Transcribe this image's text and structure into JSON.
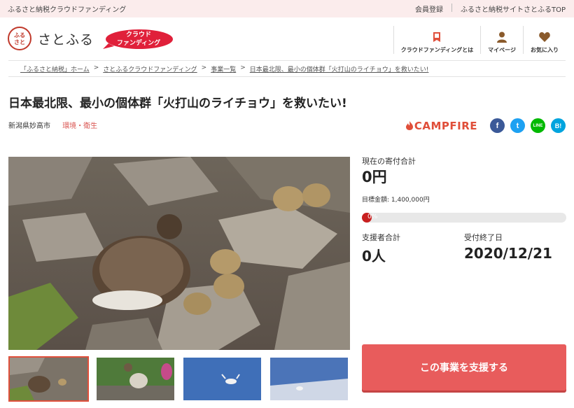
{
  "topbar": {
    "tagline": "ふるさと納税クラウドファンディング",
    "links": [
      "会員登録",
      "ふるさと納税サイトさとふるTOP"
    ]
  },
  "header": {
    "logo_mark": "さとふる",
    "logo_text": "さとふる",
    "badge": [
      "クラウド",
      "ファンディング"
    ],
    "nav": [
      {
        "label": "クラウドファンディングとは",
        "icon": "book-icon"
      },
      {
        "label": "マイページ",
        "icon": "user-icon"
      },
      {
        "label": "お気に入り",
        "icon": "heart-icon"
      }
    ]
  },
  "breadcrumb": [
    "「ふるさと納税」ホーム",
    "さとふるクラウドファンディング",
    "事業一覧",
    "日本最北限、最小の個体群「火打山のライチョウ」を救いたい!"
  ],
  "project": {
    "title": "日本最北限、最小の個体群「火打山のライチョウ」を救いたい!",
    "city": "新潟県妙高市",
    "category": "環境・衛生"
  },
  "share": {
    "campfire": "CAMPFIRE",
    "buttons": [
      "f",
      "t",
      "LINE",
      "B!"
    ]
  },
  "stats": {
    "total_label": "現在の寄付合計",
    "total_value": "0円",
    "goal_label": "目標金額: 1,400,000円",
    "progress_label": "0%",
    "progress_fraction": 0,
    "supporters_label": "支援者合計",
    "supporters_value": "0人",
    "deadline_label": "受付終了日",
    "deadline_value": "2020/12/21"
  },
  "cta": {
    "label": "この事業を支援する"
  },
  "colors": {
    "accent": "#e85c5c",
    "topbar_bg": "#fbecec",
    "campfire": "#e04e39"
  }
}
